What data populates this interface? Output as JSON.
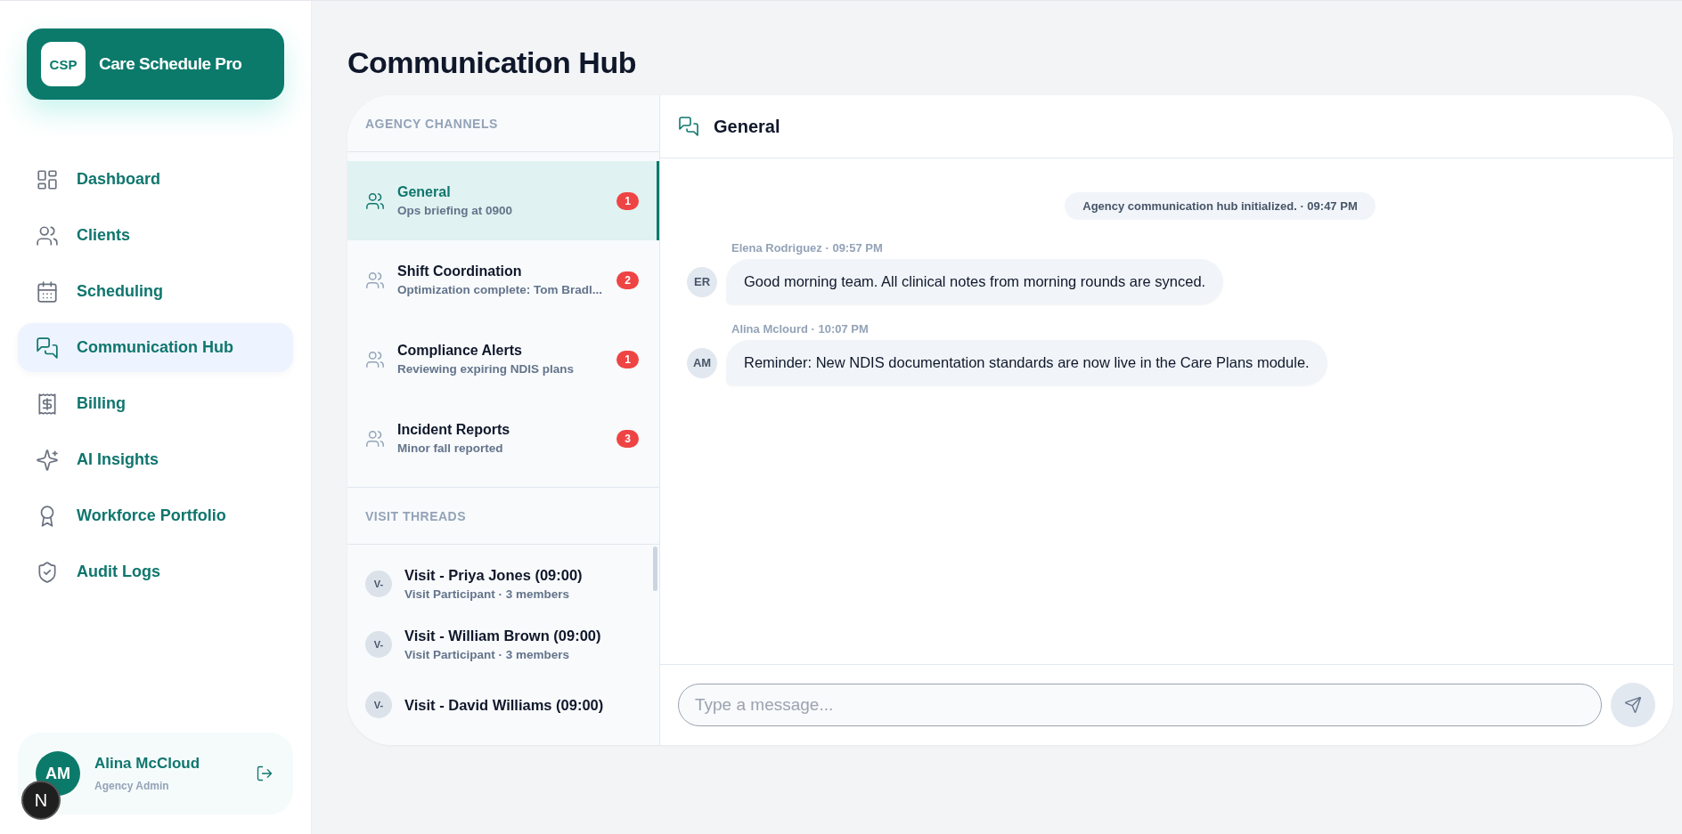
{
  "brand": {
    "logo": "CSP",
    "name": "Care Schedule Pro"
  },
  "nav": [
    {
      "label": "Dashboard",
      "selected": false
    },
    {
      "label": "Clients",
      "selected": false
    },
    {
      "label": "Scheduling",
      "selected": false
    },
    {
      "label": "Communication Hub",
      "selected": true
    },
    {
      "label": "Billing",
      "selected": false
    },
    {
      "label": "AI Insights",
      "selected": false
    },
    {
      "label": "Workforce Portfolio",
      "selected": false
    },
    {
      "label": "Audit Logs",
      "selected": false
    }
  ],
  "user": {
    "initials": "AM",
    "name": "Alina McCloud",
    "role": "Agency Admin"
  },
  "dev_badge": "N",
  "page_title": "Communication Hub",
  "channels": {
    "heading": "AGENCY CHANNELS",
    "items": [
      {
        "name": "General",
        "preview": "Ops briefing at 0900",
        "unread": "1",
        "selected": true
      },
      {
        "name": "Shift Coordination",
        "preview": "Optimization complete: Tom Bradl...",
        "unread": "2",
        "selected": false
      },
      {
        "name": "Compliance Alerts",
        "preview": "Reviewing expiring NDIS plans",
        "unread": "1",
        "selected": false
      },
      {
        "name": "Incident Reports",
        "preview": "Minor fall reported",
        "unread": "3",
        "selected": false
      }
    ]
  },
  "visit_threads": {
    "heading": "VISIT THREADS",
    "items": [
      {
        "avatar": "V-",
        "name": "Visit - Priya Jones (09:00)",
        "meta": "Visit Participant · 3 members"
      },
      {
        "avatar": "V-",
        "name": "Visit - William Brown (09:00)",
        "meta": "Visit Participant · 3 members"
      },
      {
        "avatar": "V-",
        "name": "Visit - David Williams (09:00)"
      }
    ]
  },
  "chat": {
    "title": "General",
    "messages": [
      {
        "kind": "system",
        "text": "Agency communication hub initialized. · 09:47 PM"
      },
      {
        "kind": "message",
        "initials": "ER",
        "meta": "Elena Rodriguez · 09:57 PM",
        "text": "Good morning team. All clinical notes from morning rounds are synced."
      },
      {
        "kind": "message",
        "initials": "AM",
        "meta": "Alina Mclourd · 10:07 PM",
        "text": "Reminder: New NDIS documentation standards are now live in the Care Plans module."
      }
    ],
    "composer": {
      "placeholder": "Type a message..."
    }
  }
}
